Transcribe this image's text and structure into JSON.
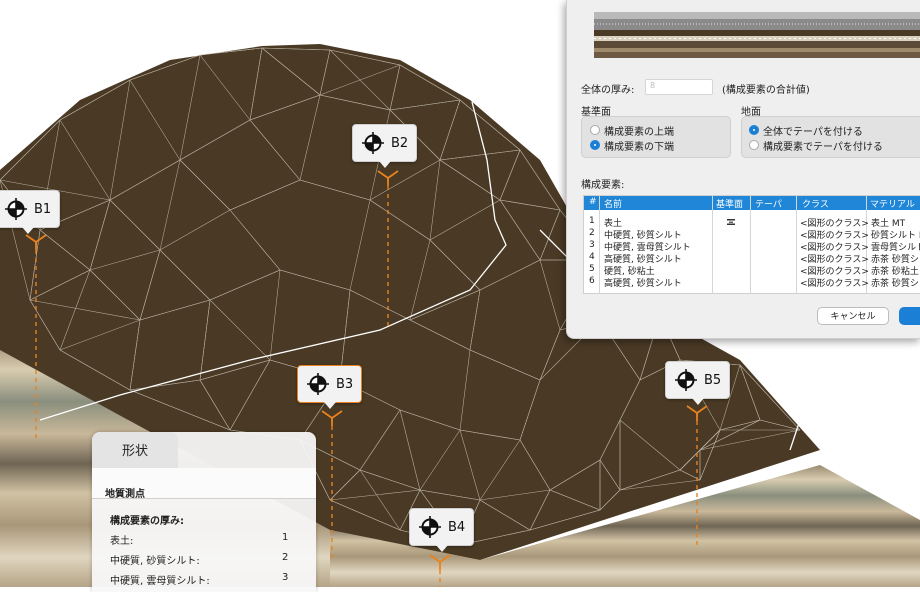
{
  "markers": [
    {
      "label": "B1",
      "selected": false
    },
    {
      "label": "B2",
      "selected": false
    },
    {
      "label": "B3",
      "selected": true
    },
    {
      "label": "B4",
      "selected": false
    },
    {
      "label": "B5",
      "selected": false
    }
  ],
  "dialog": {
    "thickness_label": "全体の厚み:",
    "thickness_value": "8",
    "thickness_note": "(構成要素の合計値)",
    "base_label": "基準面",
    "base_options": [
      {
        "label": "構成要素の上端",
        "selected": false
      },
      {
        "label": "構成要素の下端",
        "selected": true
      }
    ],
    "ground_label": "地面",
    "ground_options": [
      {
        "label": "全体でテーパを付ける",
        "selected": true
      },
      {
        "label": "構成要素でテーパを付ける",
        "selected": false
      }
    ],
    "components_label": "構成要素:",
    "columns": [
      "#",
      "名前",
      "基準面",
      "テーパ",
      "クラス",
      "マテリアル"
    ],
    "rows": [
      {
        "num": "1",
        "name": "表土",
        "base_icon": "base-surface-icon",
        "taper": "",
        "class": "<図形のクラス>",
        "material": "表土 MT"
      },
      {
        "num": "2",
        "name": "中硬質, 砂質シルト",
        "taper": "",
        "class": "<図形のクラス>",
        "material": "砂質シルト M"
      },
      {
        "num": "3",
        "name": "中硬質, 雲母質シルト",
        "taper": "",
        "class": "<図形のクラス>",
        "material": "雲母質シルト"
      },
      {
        "num": "4",
        "name": "高硬質, 砂質シルト",
        "taper": "",
        "class": "<図形のクラス>",
        "material": "赤茶 砂質シ"
      },
      {
        "num": "5",
        "name": "硬質, 砂粘土",
        "taper": "",
        "class": "<図形のクラス>",
        "material": "赤茶 砂粘土"
      },
      {
        "num": "6",
        "name": "高硬質, 砂質シルト",
        "taper": "",
        "class": "<図形のクラス>",
        "material": "赤茶 砂質シ"
      }
    ],
    "cancel_label": "キャンセル",
    "ok_label": ""
  },
  "panel": {
    "tab_label": "形状",
    "section_title": "地質測点",
    "thickness_title": "構成要素の厚み:",
    "rows": [
      {
        "label": "表土:",
        "value": "1"
      },
      {
        "label": "中硬質, 砂質シルト:",
        "value": "2"
      },
      {
        "label": "中硬質, 雲母質シルト:",
        "value": "3"
      }
    ]
  },
  "colors": {
    "terrain": "#4a3a25",
    "accent_orange": "#e8821e",
    "selection_blue": "#1c7fd6"
  }
}
